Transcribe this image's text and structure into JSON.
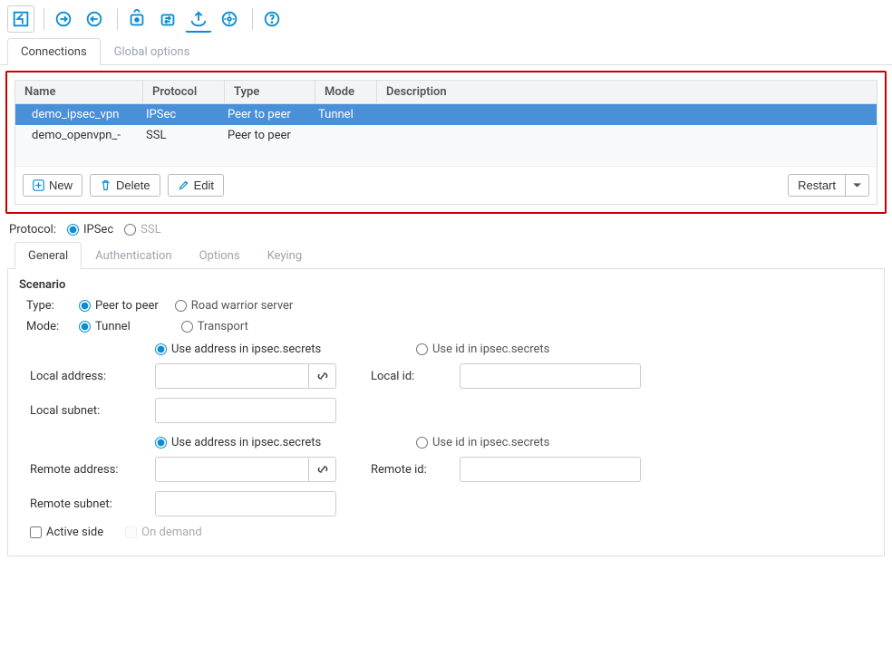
{
  "topTabs": {
    "connections": "Connections",
    "globalOptions": "Global options"
  },
  "table": {
    "headers": {
      "name": "Name",
      "protocol": "Protocol",
      "type": "Type",
      "mode": "Mode",
      "description": "Description"
    },
    "rows": [
      {
        "name": "demo_ipsec_vpn",
        "protocol": "IPSec",
        "type": "Peer to peer",
        "mode": "Tunnel",
        "description": "",
        "selected": true
      },
      {
        "name": "demo_openvpn_-",
        "protocol": "SSL",
        "type": "Peer to peer",
        "mode": "",
        "description": "",
        "selected": false
      }
    ],
    "actions": {
      "new": "New",
      "delete": "Delete",
      "edit": "Edit",
      "restart": "Restart"
    }
  },
  "protocol": {
    "label": "Protocol:",
    "ipsec": "IPSec",
    "ssl": "SSL",
    "selected": "ipsec"
  },
  "detailTabs": {
    "general": "General",
    "authentication": "Authentication",
    "options": "Options",
    "keying": "Keying"
  },
  "scenario": {
    "title": "Scenario",
    "typeLabel": "Type:",
    "type": {
      "peerToPeer": "Peer to peer",
      "roadWarrior": "Road warrior server",
      "selected": "peer"
    },
    "modeLabel": "Mode:",
    "mode": {
      "tunnel": "Tunnel",
      "transport": "Transport",
      "selected": "tunnel"
    },
    "useAddressSecrets": "Use address in ipsec.secrets",
    "useIdSecrets": "Use id in ipsec.secrets",
    "localAddress": "Local address:",
    "localId": "Local id:",
    "localSubnet": "Local subnet:",
    "remoteAddress": "Remote address:",
    "remoteId": "Remote id:",
    "remoteSubnet": "Remote subnet:",
    "activeSide": "Active side",
    "onDemand": "On demand",
    "values": {
      "localAddress": "",
      "localId": "",
      "localSubnet": "",
      "remoteAddress": "",
      "remoteId": "",
      "remoteSubnet": ""
    }
  }
}
